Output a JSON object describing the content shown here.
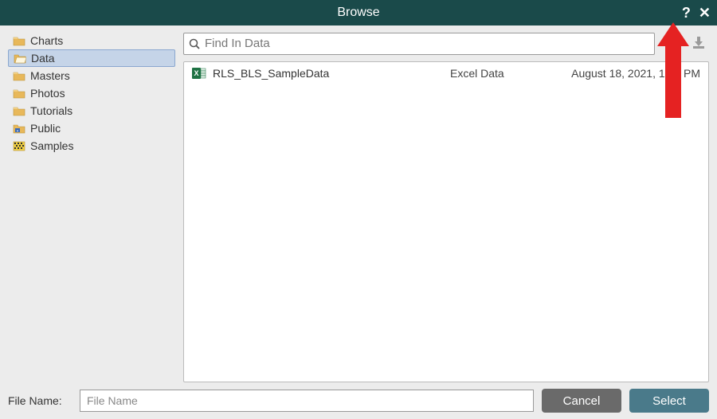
{
  "title": "Browse",
  "sidebar": {
    "items": [
      {
        "label": "Charts",
        "icon": "folder",
        "selected": false
      },
      {
        "label": "Data",
        "icon": "folder-open",
        "selected": true
      },
      {
        "label": "Masters",
        "icon": "folder",
        "selected": false
      },
      {
        "label": "Photos",
        "icon": "folder",
        "selected": false
      },
      {
        "label": "Tutorials",
        "icon": "folder",
        "selected": false
      },
      {
        "label": "Public",
        "icon": "folder-public",
        "selected": false
      },
      {
        "label": "Samples",
        "icon": "folder-samples",
        "selected": false
      }
    ]
  },
  "search": {
    "placeholder": "Find In Data",
    "value": ""
  },
  "files": [
    {
      "name": "RLS_BLS_SampleData",
      "type": "Excel Data",
      "date": "August 18, 2021, 1:00 PM",
      "icon": "excel"
    }
  ],
  "filename": {
    "label": "File Name:",
    "placeholder": "File Name",
    "value": ""
  },
  "buttons": {
    "cancel": "Cancel",
    "select": "Select"
  },
  "colors": {
    "titlebar": "#1a4a4a",
    "arrow": "#e52222",
    "upload": "#1a4a4a",
    "download": "#9a9a9a"
  }
}
